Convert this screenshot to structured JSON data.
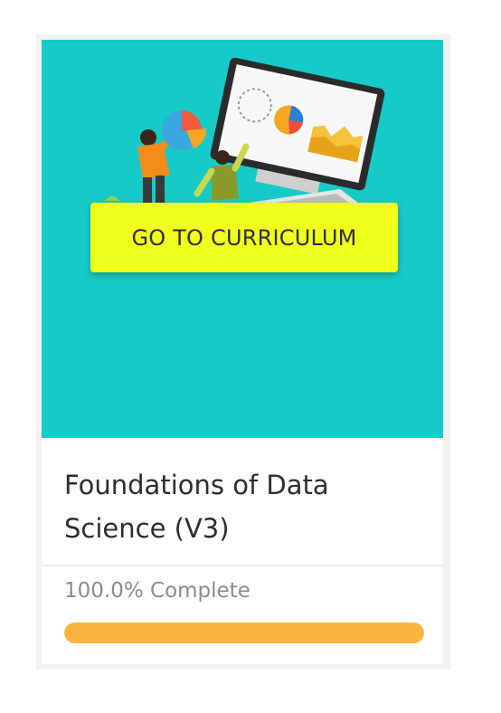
{
  "course": {
    "title": "Foundations of Data Science (V3)",
    "cta_label": "GO TO CURRICULUM",
    "progress_text": "100.0% Complete",
    "progress_percent": 100
  },
  "colors": {
    "hero_bg": "#16cbc7",
    "cta_bg": "#f1ff1c",
    "progress_fill": "#fcb340"
  },
  "icons": [
    "data-analytics-illustration"
  ]
}
